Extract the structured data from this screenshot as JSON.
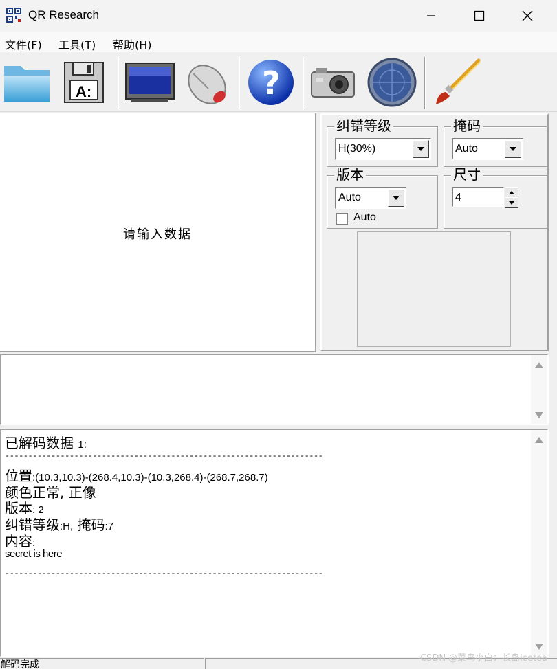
{
  "window": {
    "title": "QR Research"
  },
  "menu": [
    {
      "label": "文件(F)"
    },
    {
      "label": "工具(T)"
    },
    {
      "label": "帮助(H)"
    }
  ],
  "toolbar_icons": [
    "folder-icon",
    "floppy-save-icon",
    "monitor-icon",
    "mouse-icon",
    "help-icon",
    "camera-icon",
    "radar-icon",
    "paintbrush-icon"
  ],
  "input": {
    "placeholder": "请输入数据"
  },
  "settings": {
    "ecc_label": "纠错等级",
    "ecc_value": "H(30%)",
    "mask_label": "掩码",
    "mask_value": "Auto",
    "version_label": "版本",
    "version_value": "Auto",
    "version_auto_label": "Auto",
    "size_label": "尺寸",
    "size_value": "4"
  },
  "output": {
    "header": "已解码数据",
    "header_num": "1:",
    "divider": "---------------------------------------------------------------------",
    "position_label": "位置",
    "position_value": ":(10.3,10.3)-(268.4,10.3)-(10.3,268.4)-(268.7,268.7)",
    "color_line": "颜色正常, 正像",
    "version_label": "版本",
    "version_value": ": 2",
    "ecc_label": "纠错等级",
    "ecc_value": ":H,",
    "mask_label": "掩码",
    "mask_value": ":7",
    "content_label": "内容",
    "content_colon": ":",
    "content_value": "secret is here"
  },
  "status": {
    "text": "解码完成"
  },
  "watermark": "CSDN @菜鸟小白：长岛icetea",
  "colors": {
    "window_bg": "#f0f0f0",
    "pane_bg": "#ffffff"
  }
}
